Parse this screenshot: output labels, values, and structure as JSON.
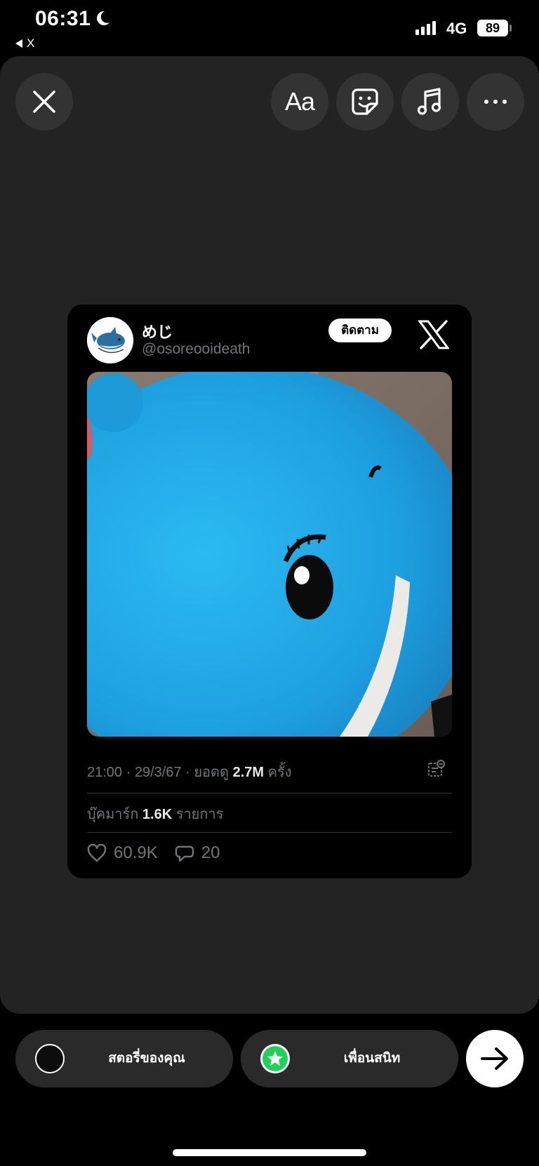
{
  "status_bar": {
    "time": "06:31",
    "back_app": "X",
    "network": "4G",
    "battery": "89"
  },
  "toolbar": {
    "close_icon": "close-icon",
    "text_label": "Aa",
    "sticker_icon": "sticker-icon",
    "music_icon": "music-icon",
    "more_icon": "more-icon"
  },
  "tweet": {
    "display_name": "めじ",
    "handle": "@osoreooideath",
    "follow_label": "ติดตาม",
    "meta_prefix": "21:00 · 29/3/67 · ยอดดู ",
    "views": "2.7M",
    "views_suffix": " ครั้ง",
    "bookmarks_prefix": "บุ๊คมาร์ก ",
    "bookmarks": "1.6K",
    "bookmarks_suffix": " รายการ",
    "likes": "60.9K",
    "replies": "20"
  },
  "share": {
    "your_story": "สตอรี่ของคุณ",
    "close_friends": "เพื่อนสนิท"
  },
  "colors": {
    "accent_green": "#1fd15a",
    "editor_bg": "#232323",
    "plush_blue": "#1ea8e6"
  }
}
